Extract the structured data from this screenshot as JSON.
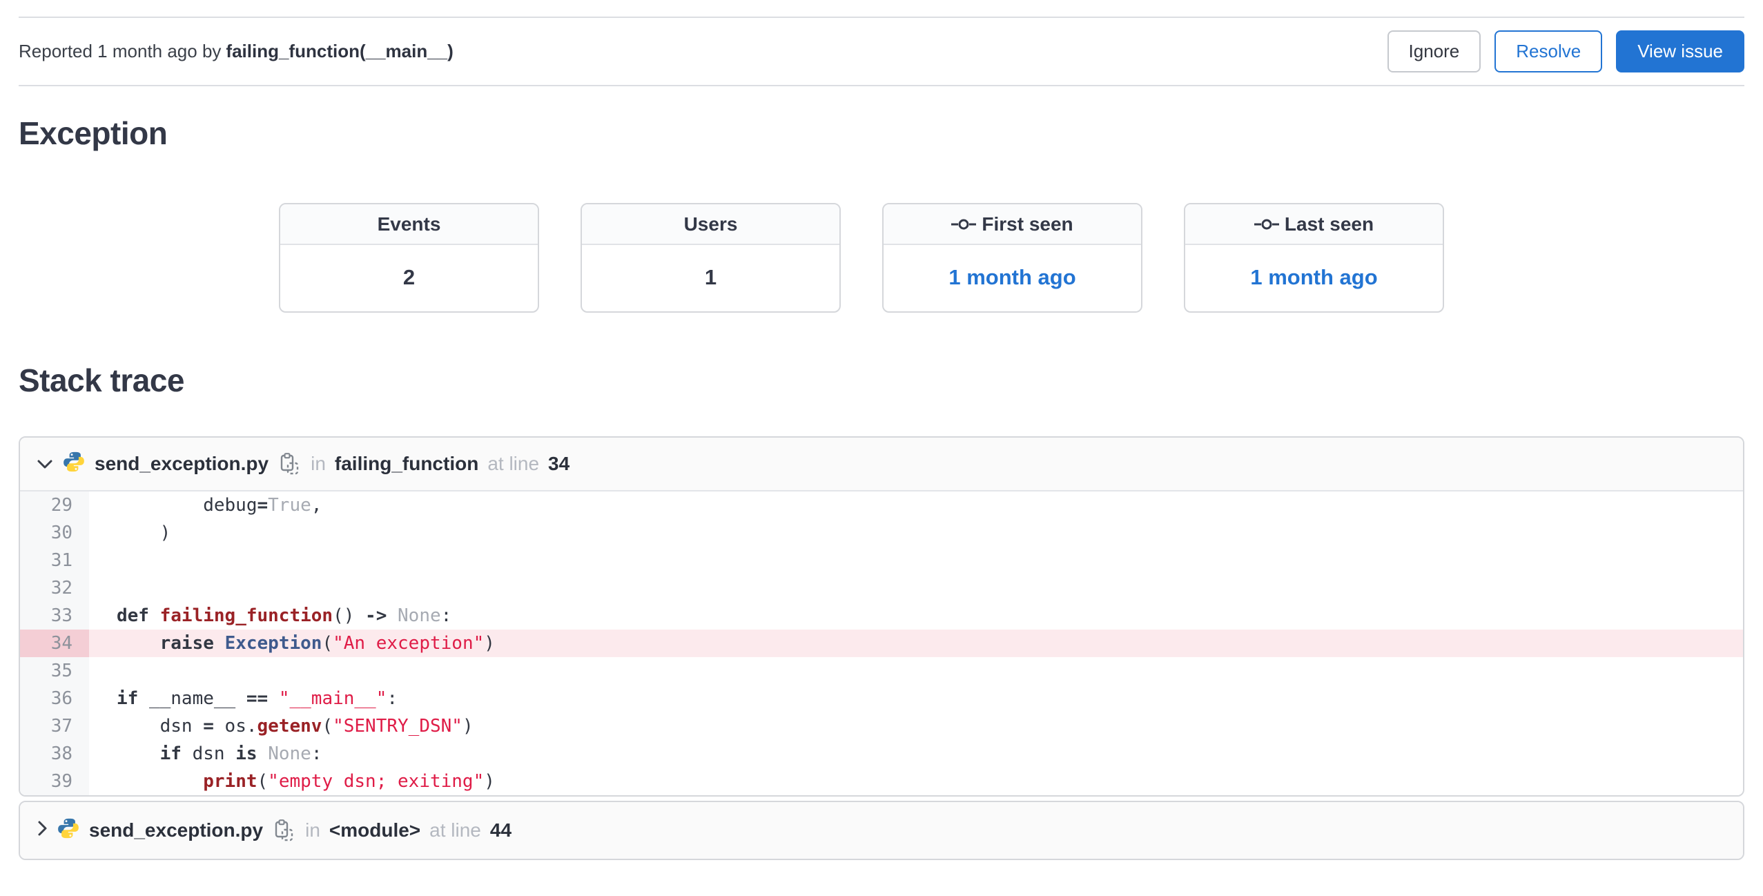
{
  "header_bar": {
    "reported_prefix": "Reported 1 month ago by",
    "reporter": "failing_function(__main__)",
    "ignore_label": "Ignore",
    "resolve_label": "Resolve",
    "view_issue_label": "View issue"
  },
  "sections": {
    "exception_title": "Exception",
    "stack_trace_title": "Stack trace"
  },
  "stats": [
    {
      "label": "Events",
      "value": "2"
    },
    {
      "label": "Users",
      "value": "1"
    },
    {
      "label": "First seen",
      "value": "1 month ago",
      "icon": "commit-icon",
      "link": true
    },
    {
      "label": "Last seen",
      "value": "1 month ago",
      "icon": "commit-icon",
      "link": true
    }
  ],
  "frames": [
    {
      "file": "send_exception.py",
      "in_word": "in",
      "function": "failing_function",
      "at_words": "at line",
      "line": "34",
      "expanded": true
    },
    {
      "file": "send_exception.py",
      "in_word": "in",
      "function": "<module>",
      "at_words": "at line",
      "line": "44",
      "expanded": false
    }
  ],
  "code_lines": [
    {
      "no": "29",
      "tokens": [
        [
          "plain",
          "        debug"
        ],
        [
          "op",
          "="
        ],
        [
          "lit",
          "True"
        ],
        [
          "plain",
          ","
        ]
      ]
    },
    {
      "no": "30",
      "tokens": [
        [
          "plain",
          "    )"
        ]
      ]
    },
    {
      "no": "31",
      "tokens": []
    },
    {
      "no": "32",
      "tokens": []
    },
    {
      "no": "33",
      "tokens": [
        [
          "kw",
          "def"
        ],
        [
          "plain",
          " "
        ],
        [
          "fn",
          "failing_function"
        ],
        [
          "plain",
          "() "
        ],
        [
          "op",
          "->"
        ],
        [
          "plain",
          " "
        ],
        [
          "lit",
          "None"
        ],
        [
          "plain",
          ":"
        ]
      ]
    },
    {
      "no": "34",
      "highlight": true,
      "tokens": [
        [
          "plain",
          "    "
        ],
        [
          "kw",
          "raise"
        ],
        [
          "plain",
          " "
        ],
        [
          "cls",
          "Exception"
        ],
        [
          "plain",
          "("
        ],
        [
          "str",
          "\"An exception\""
        ],
        [
          "plain",
          ")"
        ]
      ]
    },
    {
      "no": "35",
      "tokens": []
    },
    {
      "no": "36",
      "tokens": [
        [
          "kw",
          "if"
        ],
        [
          "plain",
          " __name__ "
        ],
        [
          "op",
          "=="
        ],
        [
          "plain",
          " "
        ],
        [
          "str",
          "\"__main__\""
        ],
        [
          "plain",
          ":"
        ]
      ]
    },
    {
      "no": "37",
      "tokens": [
        [
          "plain",
          "    dsn "
        ],
        [
          "op",
          "="
        ],
        [
          "plain",
          " os."
        ],
        [
          "fn",
          "getenv"
        ],
        [
          "plain",
          "("
        ],
        [
          "str",
          "\"SENTRY_DSN\""
        ],
        [
          "plain",
          ")"
        ]
      ]
    },
    {
      "no": "38",
      "tokens": [
        [
          "plain",
          "    "
        ],
        [
          "kw",
          "if"
        ],
        [
          "plain",
          " dsn "
        ],
        [
          "kw",
          "is"
        ],
        [
          "plain",
          " "
        ],
        [
          "lit",
          "None"
        ],
        [
          "plain",
          ":"
        ]
      ]
    },
    {
      "no": "39",
      "tokens": [
        [
          "plain",
          "        "
        ],
        [
          "fn",
          "print"
        ],
        [
          "plain",
          "("
        ],
        [
          "str",
          "\"empty dsn; exiting\""
        ],
        [
          "plain",
          ")"
        ]
      ]
    }
  ],
  "icons": {
    "stat_seen": "commit-icon",
    "frame_language": "python-icon",
    "frame_copy": "copy-icon",
    "frame_expanded": "chevron-down-icon",
    "frame_collapsed": "chevron-right-icon"
  },
  "colors": {
    "accent_blue": "#2274d3",
    "link_blue": "#2274d3",
    "divider": "#dcdee2",
    "card_border": "#d5d7db",
    "frame_header_bg": "#fafafa",
    "syntax_keyword": "#323742",
    "syntax_function": "#9a2226",
    "syntax_class": "#3f5a8d",
    "syntax_string": "#df1c47",
    "syntax_literal": "#a6aab2",
    "highlight_row": "#fceaed",
    "highlight_gutter": "#f4ced5",
    "python_blue": "#3776ab",
    "python_yellow": "#ffd43b"
  }
}
